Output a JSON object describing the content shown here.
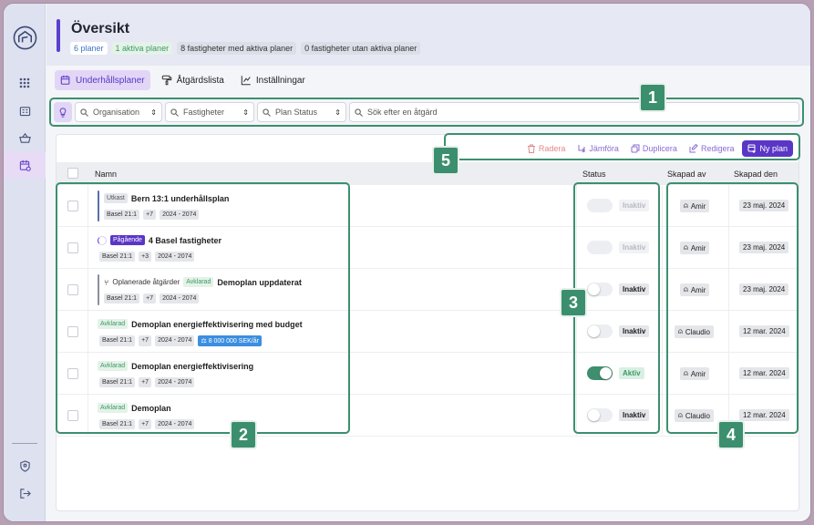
{
  "header": {
    "title": "Översikt",
    "stats": [
      {
        "label": "6 planer",
        "style": "blue"
      },
      {
        "label": "1 aktiva planer",
        "style": "green"
      },
      {
        "label": "8 fastigheter med aktiva planer",
        "style": "plain"
      },
      {
        "label": "0 fastigheter utan aktiva planer",
        "style": "plain"
      }
    ]
  },
  "tabs": [
    {
      "label": "Underhållsplaner",
      "icon": "calendar-icon",
      "active": true
    },
    {
      "label": "Åtgärdslista",
      "icon": "paint-roller-icon",
      "active": false
    },
    {
      "label": "Inställningar",
      "icon": "chart-icon",
      "active": false
    }
  ],
  "filters": {
    "organisation": "Organisation",
    "fastigheter": "Fastigheter",
    "plan_status": "Plan Status",
    "search_placeholder": "Sök efter en åtgärd"
  },
  "actions": {
    "radera": "Radera",
    "jamfora": "Jämföra",
    "duplicera": "Duplicera",
    "redigera": "Redigera",
    "ny_plan": "Ny plan"
  },
  "table": {
    "columns": {
      "namn": "Namn",
      "status": "Status",
      "skapad_av": "Skapad av",
      "skapad_den": "Skapad den"
    },
    "rows": [
      {
        "status_tag": "Utkast",
        "name": "Bern 13:1 underhållsplan",
        "property": "Basel 21:1",
        "extra": "+7",
        "years": "2024 - 2074",
        "toggle": "disabled",
        "status": "Inaktiv",
        "creator": "Amir",
        "created": "23 maj. 2024"
      },
      {
        "status_tag": "Pågående",
        "name": "4 Basel fastigheter",
        "property": "Basel 21:1",
        "extra": "+3",
        "years": "2024 - 2074",
        "toggle": "disabled",
        "status": "Inaktiv",
        "creator": "Amir",
        "created": "23 maj. 2024"
      },
      {
        "prefix": "Oplanerade åtgärder",
        "status_tag": "Avklarad",
        "name": "Demoplan uppdaterat",
        "property": "Basel 21:1",
        "extra": "+7",
        "years": "2024 - 2074",
        "toggle": "off",
        "status": "Inaktiv",
        "creator": "Amir",
        "created": "23 maj. 2024"
      },
      {
        "status_tag": "Avklarad",
        "name": "Demoplan energieffektivisering med budget",
        "property": "Basel 21:1",
        "extra": "+7",
        "years": "2024 - 2074",
        "budget": "8 000 000 SEK/år",
        "toggle": "off",
        "status": "Inaktiv",
        "creator": "Claudio",
        "created": "12 mar. 2024"
      },
      {
        "status_tag": "Avklarad",
        "name": "Demoplan energieffektivisering",
        "property": "Basel 21:1",
        "extra": "+7",
        "years": "2024 - 2074",
        "toggle": "on",
        "status": "Aktiv",
        "creator": "Amir",
        "created": "12 mar. 2024"
      },
      {
        "status_tag": "Avklarad",
        "name": "Demoplan",
        "property": "Basel 21:1",
        "extra": "+7",
        "years": "2024 - 2074",
        "toggle": "off",
        "status": "Inaktiv",
        "creator": "Claudio",
        "created": "12 mar. 2024"
      }
    ]
  },
  "annotations": [
    "1",
    "2",
    "3",
    "4",
    "5"
  ],
  "colors": {
    "accent": "#5a36c6",
    "annotation": "#3c8f6e",
    "active_status": "#3b9a67"
  }
}
